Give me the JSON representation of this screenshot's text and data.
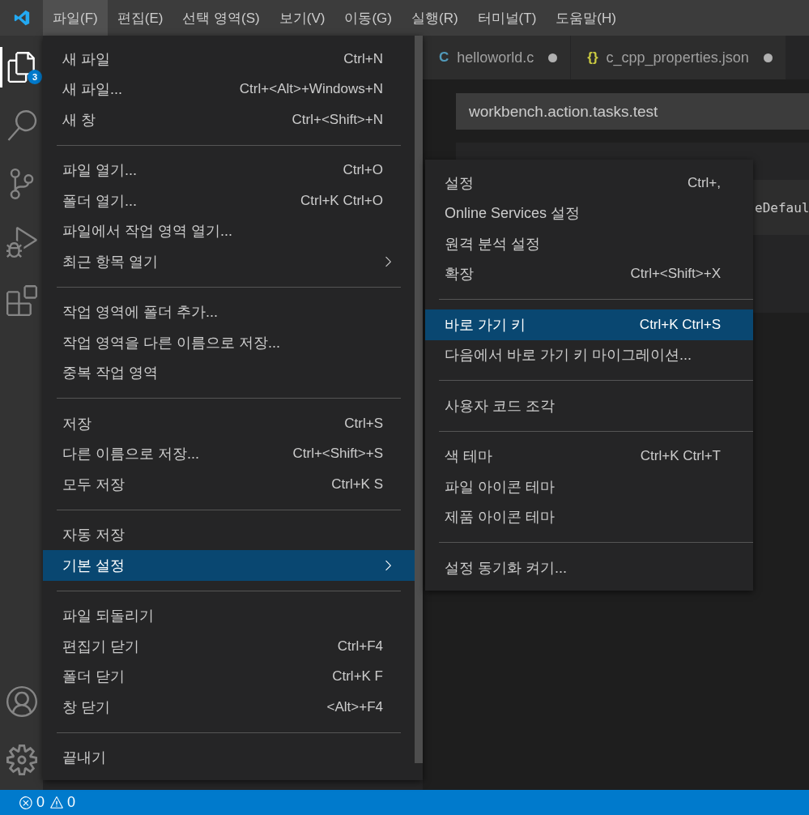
{
  "menubar": {
    "items": [
      {
        "label": "파일(F)",
        "selected": true
      },
      {
        "label": "편집(E)",
        "selected": false
      },
      {
        "label": "선택 영역(S)",
        "selected": false
      },
      {
        "label": "보기(V)",
        "selected": false
      },
      {
        "label": "이동(G)",
        "selected": false
      },
      {
        "label": "실행(R)",
        "selected": false
      },
      {
        "label": "터미널(T)",
        "selected": false
      },
      {
        "label": "도움말(H)",
        "selected": false
      }
    ]
  },
  "activity_bar": {
    "items": [
      {
        "kind": "explorer",
        "selected": true,
        "badge": "3"
      },
      {
        "kind": "search",
        "selected": false
      },
      {
        "kind": "source-control",
        "selected": false
      },
      {
        "kind": "run",
        "selected": false
      },
      {
        "kind": "extensions",
        "selected": false
      }
    ],
    "bottom_items": [
      {
        "kind": "account",
        "selected": false
      },
      {
        "kind": "settings",
        "selected": false
      }
    ]
  },
  "tabs": [
    {
      "icon": "C",
      "color": "#519aba",
      "label": "helloworld.c",
      "dirty": true
    },
    {
      "icon": "{}",
      "color": "#cbcb41",
      "label": "c_cpp_properties.json",
      "dirty": true
    }
  ],
  "editor": {
    "command_value": "workbench.action.tasks.test",
    "fragment": "eDefaul"
  },
  "file_menu": {
    "groups": [
      [
        {
          "label": "새 파일",
          "shortcut": "Ctrl+N",
          "submenu": false,
          "selected": false
        },
        {
          "label": "새 파일...",
          "shortcut": "Ctrl+<Alt>+Windows+N",
          "submenu": false,
          "selected": false
        },
        {
          "label": "새 창",
          "shortcut": "Ctrl+<Shift>+N",
          "submenu": false,
          "selected": false
        }
      ],
      [
        {
          "label": "파일 열기...",
          "shortcut": "Ctrl+O",
          "submenu": false,
          "selected": false
        },
        {
          "label": "폴더 열기...",
          "shortcut": "Ctrl+K Ctrl+O",
          "submenu": false,
          "selected": false
        },
        {
          "label": "파일에서 작업 영역 열기...",
          "submenu": false,
          "selected": false
        },
        {
          "label": "최근 항목 열기",
          "submenu": true,
          "selected": false
        }
      ],
      [
        {
          "label": "작업 영역에 폴더 추가...",
          "submenu": false,
          "selected": false
        },
        {
          "label": "작업 영역을 다른 이름으로 저장...",
          "submenu": false,
          "selected": false
        },
        {
          "label": "중복 작업 영역",
          "submenu": false,
          "selected": false
        }
      ],
      [
        {
          "label": "저장",
          "shortcut": "Ctrl+S",
          "submenu": false,
          "selected": false
        },
        {
          "label": "다른 이름으로 저장...",
          "shortcut": "Ctrl+<Shift>+S",
          "submenu": false,
          "selected": false
        },
        {
          "label": "모두 저장",
          "shortcut": "Ctrl+K S",
          "submenu": false,
          "selected": false
        }
      ],
      [
        {
          "label": "자동 저장",
          "submenu": false,
          "selected": false
        },
        {
          "label": "기본 설정",
          "submenu": true,
          "selected": true
        }
      ],
      [
        {
          "label": "파일 되돌리기",
          "submenu": false,
          "selected": false
        },
        {
          "label": "편집기 닫기",
          "shortcut": "Ctrl+F4",
          "submenu": false,
          "selected": false
        },
        {
          "label": "폴더 닫기",
          "shortcut": "Ctrl+K F",
          "submenu": false,
          "selected": false
        },
        {
          "label": "창 닫기",
          "shortcut": "<Alt>+F4",
          "submenu": false,
          "selected": false
        }
      ],
      [
        {
          "label": "끝내기",
          "submenu": false,
          "selected": false
        }
      ]
    ]
  },
  "preferences_submenu": {
    "groups": [
      [
        {
          "label": "설정",
          "shortcut": "Ctrl+,",
          "selected": false
        },
        {
          "label": "Online Services 설정",
          "selected": false
        },
        {
          "label": "원격 분석 설정",
          "selected": false
        },
        {
          "label": "확장",
          "shortcut": "Ctrl+<Shift>+X",
          "selected": false
        }
      ],
      [
        {
          "label": "바로 가기 키",
          "shortcut": "Ctrl+K Ctrl+S",
          "selected": true
        },
        {
          "label": "다음에서 바로 가기 키 마이그레이션...",
          "selected": false
        }
      ],
      [
        {
          "label": "사용자 코드 조각",
          "selected": false
        }
      ],
      [
        {
          "label": "색 테마",
          "shortcut": "Ctrl+K Ctrl+T",
          "selected": false
        },
        {
          "label": "파일 아이콘 테마",
          "selected": false
        },
        {
          "label": "제품 아이콘 테마",
          "selected": false
        }
      ],
      [
        {
          "label": "설정 동기화 켜기...",
          "selected": false
        }
      ]
    ]
  },
  "status_bar": {
    "errors": "0",
    "warnings": "0"
  }
}
